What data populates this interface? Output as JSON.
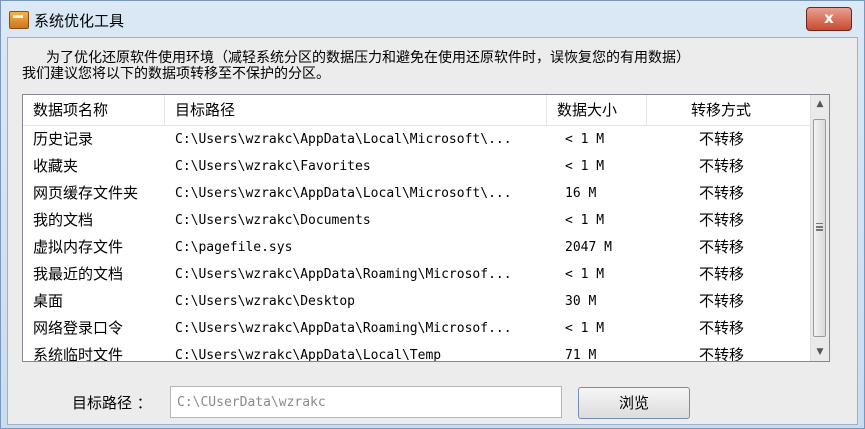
{
  "window": {
    "title": "系统优化工具",
    "close_glyph": "x"
  },
  "notice": {
    "line1": "为了优化还原软件使用环境（减轻系统分区的数据压力和避免在使用还原软件时，误恢复您的有用数据）",
    "line2": "我们建议您将以下的数据项转移至不保护的分区。"
  },
  "table": {
    "headers": [
      "数据项名称",
      "目标路径",
      "数据大小",
      "转移方式"
    ],
    "rows": [
      {
        "name": "历史记录",
        "path": "C:\\Users\\wzrakc\\AppData\\Local\\Microsoft\\...",
        "size": "< 1 M",
        "mode": "不转移"
      },
      {
        "name": "收藏夹",
        "path": "C:\\Users\\wzrakc\\Favorites",
        "size": "< 1 M",
        "mode": "不转移"
      },
      {
        "name": "网页缓存文件夹",
        "path": "C:\\Users\\wzrakc\\AppData\\Local\\Microsoft\\...",
        "size": "16 M",
        "mode": "不转移"
      },
      {
        "name": "我的文档",
        "path": "C:\\Users\\wzrakc\\Documents",
        "size": "< 1 M",
        "mode": "不转移"
      },
      {
        "name": "虚拟内存文件",
        "path": "C:\\pagefile.sys",
        "size": "2047 M",
        "mode": "不转移"
      },
      {
        "name": "我最近的文档",
        "path": "C:\\Users\\wzrakc\\AppData\\Roaming\\Microsof...",
        "size": "< 1 M",
        "mode": "不转移"
      },
      {
        "name": "桌面",
        "path": "C:\\Users\\wzrakc\\Desktop",
        "size": "30 M",
        "mode": "不转移"
      },
      {
        "name": "网络登录口令",
        "path": "C:\\Users\\wzrakc\\AppData\\Roaming\\Microsof...",
        "size": "< 1 M",
        "mode": "不转移"
      },
      {
        "name": "系统临时文件",
        "path": "C:\\Users\\wzrakc\\AppData\\Local\\Temp",
        "size": "71 M",
        "mode": "不转移"
      }
    ]
  },
  "target": {
    "label": "目标路径 ：",
    "value": "C:\\CUserData\\wzrakc"
  },
  "browse_label": "浏览"
}
